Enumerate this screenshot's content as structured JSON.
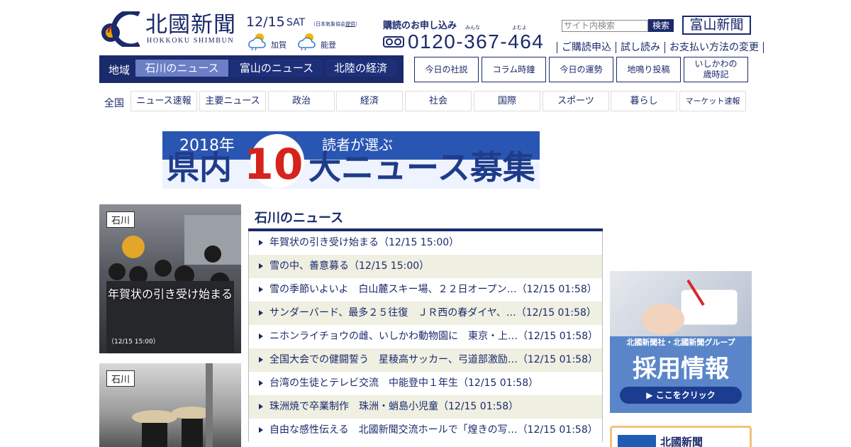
{
  "header": {
    "logo_title": "北國新聞",
    "logo_sub": "HOKKOKU SHIMBUN",
    "date": "12/15",
    "day": "SAT",
    "jma_prefix": "（日本気象協会",
    "jma_link": "提供",
    "jma_suffix": "）",
    "weather": [
      {
        "label": "加賀",
        "icon": "cloud-sun-icon"
      },
      {
        "label": "能登",
        "icon": "cloud-sun-icon"
      }
    ],
    "subscribe_heading": "購読のお申し込み",
    "ruby_minna": "みんな",
    "ruby_yomu": "よむよ",
    "free_dial_icon": "free-dial-icon",
    "phone": "0120-367-464",
    "search_placeholder": "サイト内検索",
    "search_button": "検索",
    "toyama_link": "富山新聞",
    "links": [
      "ご購読申込",
      "試し読み",
      "お支払い方法の変更"
    ]
  },
  "region_nav": {
    "label": "地域",
    "tabs": [
      "石川のニュース",
      "富山のニュース",
      "北陸の経済"
    ],
    "active_index": 0,
    "box_buttons": [
      "今日の社説",
      "コラム時鐘",
      "今日の運勢",
      "地鳴り投稿",
      "いしかわの\n歳時記"
    ]
  },
  "category_nav": {
    "label": "全国",
    "items": [
      "ニュース速報",
      "主要ニュース",
      "政治",
      "経済",
      "社会",
      "国際",
      "スポーツ",
      "暮らし",
      "マーケット速報"
    ]
  },
  "banner": {
    "year": "2018年",
    "subtitle": "読者が選ぶ",
    "title_left": "県内",
    "title_num": "10",
    "title_right": "大ニュース募集"
  },
  "photos": [
    {
      "tag": "石川",
      "title": "年賀状の引き受け始まる",
      "time": "（12/15 15:00）"
    },
    {
      "tag": "石川",
      "title": "",
      "time": ""
    }
  ],
  "news": {
    "heading": "石川のニュース",
    "items": [
      "年賀状の引き受け始まる（12/15 15:00）",
      "雪の中、善意募る（12/15 15:00）",
      "雪の季節いよいよ　白山麓スキー場、２２日オープン…（12/15 01:58）",
      "サンダーバード、最多２５往復　ＪＲ西の春ダイヤ、…（12/15 01:58）",
      "ニホンライチョウの雌、いしかわ動物園に　東京・上…（12/15 01:58）",
      "全国大会での健闘誓う　星稜高サッカー、弓道部激励…（12/15 01:58）",
      "台湾の生徒とテレビ交流　中能登中１年生（12/15 01:58）",
      "珠洲焼で卒業制作　珠洲・蛸島小児童（12/15 01:58）",
      "自由な感性伝える　北國新聞交流ホールで「煌きの写…（12/15 01:58）"
    ]
  },
  "ad": {
    "company": "北國新聞社・北國新聞グループ",
    "title": "採用情報",
    "button": "▶ ここをクリック"
  },
  "ad2": {
    "title": "北國新聞"
  },
  "colors": {
    "brand": "#1b2a6b",
    "active_tab": "#6b7fc7",
    "stripe": "#efefe2"
  }
}
